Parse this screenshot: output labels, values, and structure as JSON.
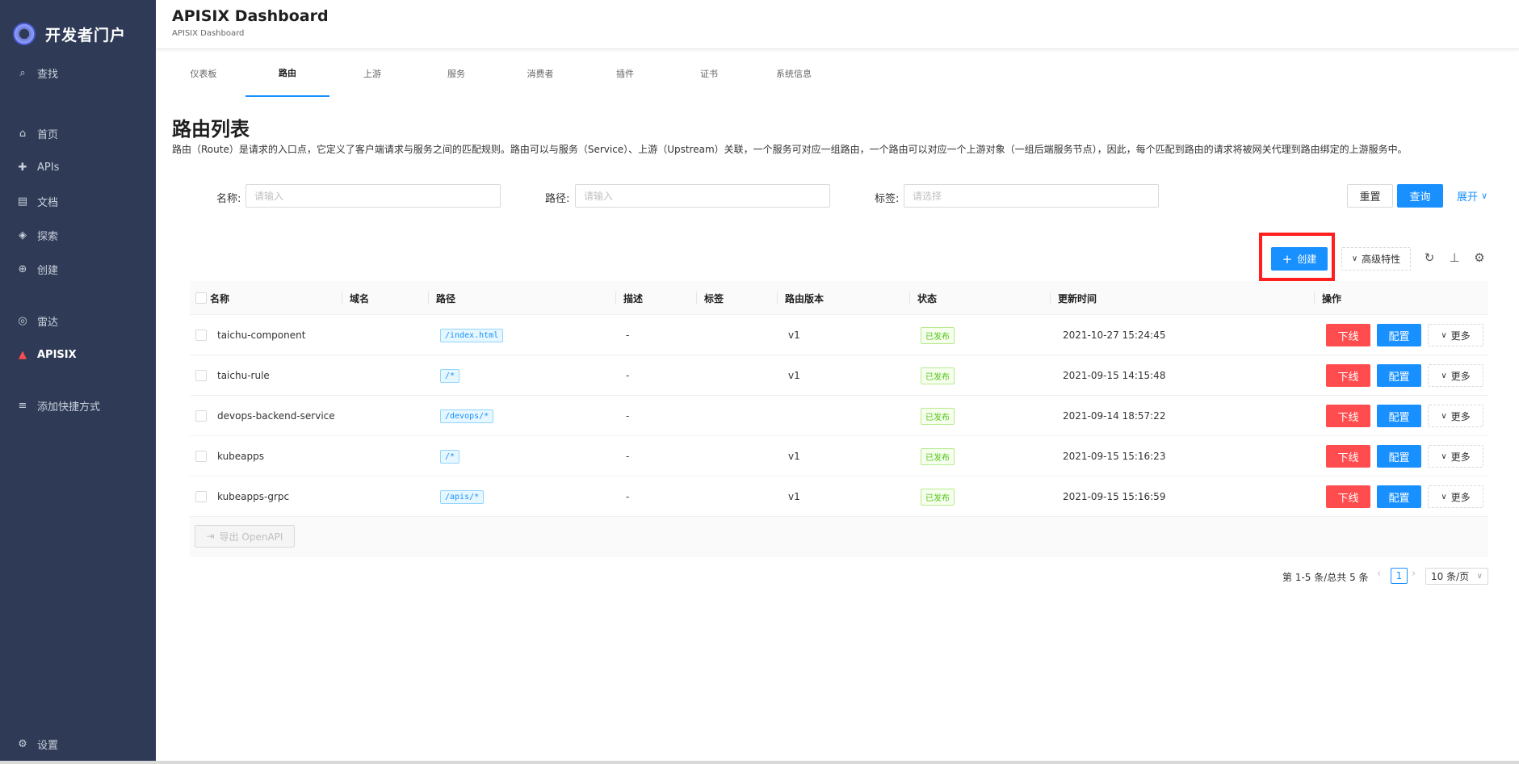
{
  "sidebar": {
    "brand": "开发者门户",
    "search": "查找",
    "items": [
      {
        "label": "首页",
        "icon": "home-icon",
        "glyph": "⌂"
      },
      {
        "label": "APIs",
        "icon": "puzzle-icon",
        "glyph": "✚"
      },
      {
        "label": "文档",
        "icon": "docs-icon",
        "glyph": "▤"
      },
      {
        "label": "探索",
        "icon": "layers-icon",
        "glyph": "◈"
      },
      {
        "label": "创建",
        "icon": "plus-circle-icon",
        "glyph": "⊕"
      }
    ],
    "items2": [
      {
        "label": "雷达",
        "icon": "radar-icon",
        "glyph": "◎"
      },
      {
        "label": "APISIX",
        "icon": "apisix-logo-icon",
        "glyph": "▲"
      }
    ],
    "shortcut": "添加快捷方式",
    "settings": "设置"
  },
  "header": {
    "title": "APISIX Dashboard",
    "subtitle": "APISIX Dashboard"
  },
  "tabs": [
    "仪表板",
    "路由",
    "上游",
    "服务",
    "消费者",
    "插件",
    "证书",
    "系统信息"
  ],
  "active_tab": "路由",
  "page": {
    "title": "路由列表",
    "description": "路由（Route）是请求的入口点，它定义了客户端请求与服务之间的匹配规则。路由可以与服务（Service）、上游（Upstream）关联，一个服务可对应一组路由，一个路由可以对应一个上游对象（一组后端服务节点），因此，每个匹配到路由的请求将被网关代理到路由绑定的上游服务中。"
  },
  "filters": {
    "name_label": "名称:",
    "name_placeholder": "请输入",
    "path_label": "路径:",
    "path_placeholder": "请输入",
    "tag_label": "标签:",
    "tag_placeholder": "请选择",
    "reset": "重置",
    "query": "查询",
    "expand": "展开"
  },
  "toolbar": {
    "create": "创建",
    "advanced": "高级特性"
  },
  "table": {
    "columns": [
      "名称",
      "域名",
      "路径",
      "描述",
      "标签",
      "路由版本",
      "状态",
      "更新时间",
      "操作"
    ],
    "rows": [
      {
        "name": "taichu-component",
        "host": "",
        "path": "/index.html",
        "desc": "-",
        "labels": "",
        "version": "v1",
        "status": "已发布",
        "updated": "2021-10-27 15:24:45"
      },
      {
        "name": "taichu-rule",
        "host": "",
        "path": "/*",
        "desc": "-",
        "labels": "",
        "version": "v1",
        "status": "已发布",
        "updated": "2021-09-15 14:15:48"
      },
      {
        "name": "devops-backend-service",
        "host": "",
        "path": "/devops/*",
        "desc": "-",
        "labels": "",
        "version": "",
        "status": "已发布",
        "updated": "2021-09-14 18:57:22"
      },
      {
        "name": "kubeapps",
        "host": "",
        "path": "/*",
        "desc": "-",
        "labels": "",
        "version": "v1",
        "status": "已发布",
        "updated": "2021-09-15 15:16:23"
      },
      {
        "name": "kubeapps-grpc",
        "host": "",
        "path": "/apis/*",
        "desc": "-",
        "labels": "",
        "version": "v1",
        "status": "已发布",
        "updated": "2021-09-15 15:16:59"
      }
    ],
    "actions": {
      "offline": "下线",
      "config": "配置",
      "more": "更多"
    },
    "export": "导出 OpenAPI"
  },
  "pagination": {
    "total": "第 1-5 条/总共 5 条",
    "current": "1",
    "page_size": "10 条/页"
  },
  "colors": {
    "sidebar": "#2f3b56",
    "primary": "#1890ff",
    "danger": "#ff4d4f",
    "highlight": "#ff1f1f"
  }
}
